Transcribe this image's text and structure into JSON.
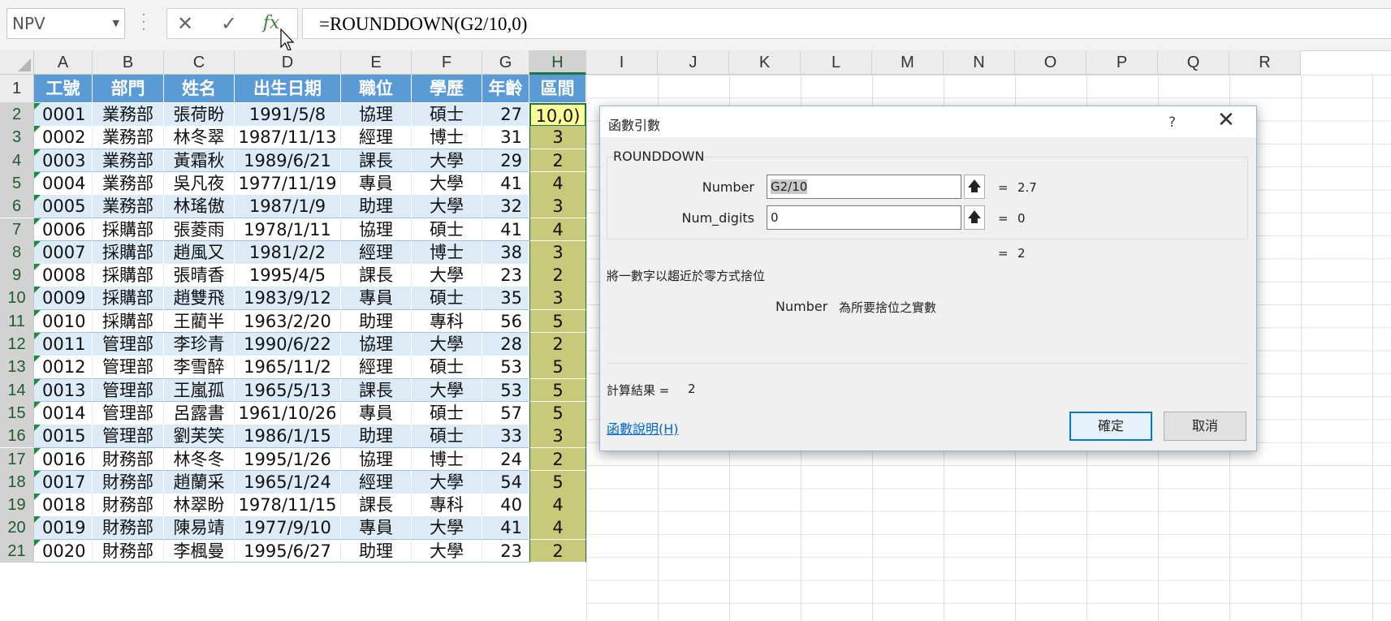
{
  "formula_bar": {
    "name_box": "NPV",
    "cancel_icon": "✕",
    "enter_icon": "✓",
    "fx_label": "fx",
    "formula": "=ROUNDDOWN(G2/10,0)"
  },
  "columns": [
    "A",
    "B",
    "C",
    "D",
    "E",
    "F",
    "G",
    "H",
    "I",
    "J",
    "K",
    "L",
    "M",
    "N",
    "O",
    "P",
    "Q",
    "R"
  ],
  "rows": [
    "1",
    "2",
    "3",
    "4",
    "5",
    "6",
    "7",
    "8",
    "9",
    "10",
    "11",
    "12",
    "13",
    "14",
    "15",
    "16",
    "17",
    "18",
    "19",
    "20",
    "21"
  ],
  "table": {
    "headers": [
      "工號",
      "部門",
      "姓名",
      "出生日期",
      "職位",
      "學歷",
      "年齡",
      "區間"
    ],
    "data": [
      [
        "0001",
        "業務部",
        "張荷盼",
        "1991/5/8",
        "協理",
        "碩士",
        "27",
        "10,0)"
      ],
      [
        "0002",
        "業務部",
        "林冬翠",
        "1987/11/13",
        "經理",
        "博士",
        "31",
        "3"
      ],
      [
        "0003",
        "業務部",
        "黃霜秋",
        "1989/6/21",
        "課長",
        "大學",
        "29",
        "2"
      ],
      [
        "0004",
        "業務部",
        "吳凡夜",
        "1977/11/19",
        "專員",
        "大學",
        "41",
        "4"
      ],
      [
        "0005",
        "業務部",
        "林瑤傲",
        "1987/1/9",
        "助理",
        "大學",
        "32",
        "3"
      ],
      [
        "0006",
        "採購部",
        "張菱雨",
        "1978/1/11",
        "協理",
        "碩士",
        "41",
        "4"
      ],
      [
        "0007",
        "採購部",
        "趙風又",
        "1981/2/2",
        "經理",
        "博士",
        "38",
        "3"
      ],
      [
        "0008",
        "採購部",
        "張晴香",
        "1995/4/5",
        "課長",
        "大學",
        "23",
        "2"
      ],
      [
        "0009",
        "採購部",
        "趙雙飛",
        "1983/9/12",
        "專員",
        "碩士",
        "35",
        "3"
      ],
      [
        "0010",
        "採購部",
        "王藺半",
        "1963/2/20",
        "助理",
        "專科",
        "56",
        "5"
      ],
      [
        "0011",
        "管理部",
        "李珍青",
        "1990/6/22",
        "協理",
        "大學",
        "28",
        "2"
      ],
      [
        "0012",
        "管理部",
        "李雪醉",
        "1965/11/2",
        "經理",
        "碩士",
        "53",
        "5"
      ],
      [
        "0013",
        "管理部",
        "王嵐孤",
        "1965/5/13",
        "課長",
        "大學",
        "53",
        "5"
      ],
      [
        "0014",
        "管理部",
        "呂露書",
        "1961/10/26",
        "專員",
        "碩士",
        "57",
        "5"
      ],
      [
        "0015",
        "管理部",
        "劉芙笑",
        "1986/1/15",
        "助理",
        "碩士",
        "33",
        "3"
      ],
      [
        "0016",
        "財務部",
        "林冬冬",
        "1995/1/26",
        "協理",
        "博士",
        "24",
        "2"
      ],
      [
        "0017",
        "財務部",
        "趙蘭采",
        "1965/1/24",
        "經理",
        "大學",
        "54",
        "5"
      ],
      [
        "0018",
        "財務部",
        "林翠盼",
        "1978/11/15",
        "課長",
        "專科",
        "40",
        "4"
      ],
      [
        "0019",
        "財務部",
        "陳易靖",
        "1977/9/10",
        "專員",
        "大學",
        "41",
        "4"
      ],
      [
        "0020",
        "財務部",
        "李楓曼",
        "1995/6/27",
        "助理",
        "大學",
        "23",
        "2"
      ]
    ]
  },
  "dialog": {
    "title": "函數引數",
    "help_icon": "?",
    "close_icon": "✕",
    "function_name": "ROUNDDOWN",
    "args": [
      {
        "label": "Number",
        "value": "G2/10",
        "result": "2.7"
      },
      {
        "label": "Num_digits",
        "value": "0",
        "result": "0"
      }
    ],
    "equals": "=",
    "overall_result": "2",
    "description": "將一數字以趨近於零方式捨位",
    "arg_help_name": "Number",
    "arg_help_text": "為所要捨位之實數",
    "calc_result_label": "計算結果 =",
    "calc_result_value": "2",
    "help_link": "函數說明(H)",
    "ok_label": "確定",
    "cancel_label": "取消"
  },
  "colors": {
    "header_fill": "#5b9bd5",
    "band_fill": "#ddebf7",
    "selected_col_fill": "#c9c97a",
    "active_cell_fill": "#ffff99",
    "excel_green": "#217346"
  }
}
